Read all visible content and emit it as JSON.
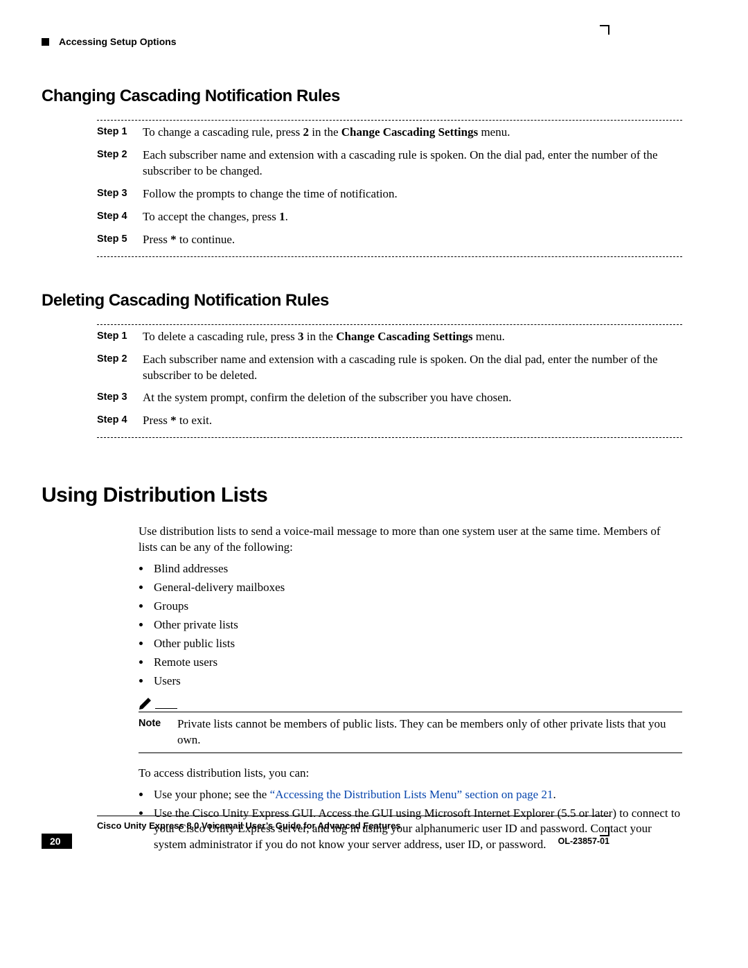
{
  "header": {
    "running": "Accessing Setup Options"
  },
  "section1": {
    "title": "Changing Cascading Notification Rules",
    "steps": [
      {
        "label": "Step 1",
        "pre": "To change a cascading rule, press ",
        "bold1": "2",
        "mid": " in the ",
        "bold2": "Change Cascading Settings",
        "post": " menu."
      },
      {
        "label": "Step 2",
        "text": "Each subscriber name and extension with a cascading rule is spoken. On the dial pad, enter the number of the subscriber to be changed."
      },
      {
        "label": "Step 3",
        "text": "Follow the prompts to change the time of notification."
      },
      {
        "label": "Step 4",
        "pre": "To accept the changes, press ",
        "bold1": "1",
        "post": "."
      },
      {
        "label": "Step 5",
        "pre": "Press ",
        "bold1": "*",
        "post": " to continue."
      }
    ]
  },
  "section2": {
    "title": "Deleting Cascading Notification Rules",
    "steps": [
      {
        "label": "Step 1",
        "pre": "To delete a cascading rule, press ",
        "bold1": "3",
        "mid": " in the ",
        "bold2": "Change Cascading Settings",
        "post": " menu."
      },
      {
        "label": "Step 2",
        "text": "Each subscriber name and extension with a cascading rule is spoken. On the dial pad, enter the number of the subscriber to be deleted."
      },
      {
        "label": "Step 3",
        "text": "At the system prompt, confirm the deletion of the subscriber you have chosen."
      },
      {
        "label": "Step 4",
        "pre": "Press ",
        "bold1": "*",
        "post": " to exit."
      }
    ]
  },
  "section3": {
    "title": "Using Distribution Lists",
    "intro": "Use distribution lists to send a voice-mail message to more than one system user at the same time. Members of lists can be any of the following:",
    "bullets": [
      "Blind addresses",
      "General-delivery mailboxes",
      "Groups",
      "Other private lists",
      "Other public lists",
      "Remote users",
      "Users"
    ],
    "note_label": "Note",
    "note": "Private lists cannot be members of public lists. They can be members only of other private lists that you own.",
    "access_intro": "To access distribution lists, you can:",
    "access1_pre": "Use your phone; see the ",
    "access1_link": "“Accessing the Distribution Lists Menu” section on page 21",
    "access1_post": ".",
    "access2": "Use the Cisco Unity Express GUI. Access the GUI using Microsoft Internet Explorer (5.5 or later) to connect to your Cisco Unity Express server, and log in using your alphanumeric user ID and password. Contact your system administrator if you do not know your server address, user ID, or password."
  },
  "footer": {
    "doc_title": "Cisco Unity Express 8.0 Voicemail User’s Guide for Advanced Features",
    "page": "20",
    "doc_id": "OL-23857-01"
  }
}
